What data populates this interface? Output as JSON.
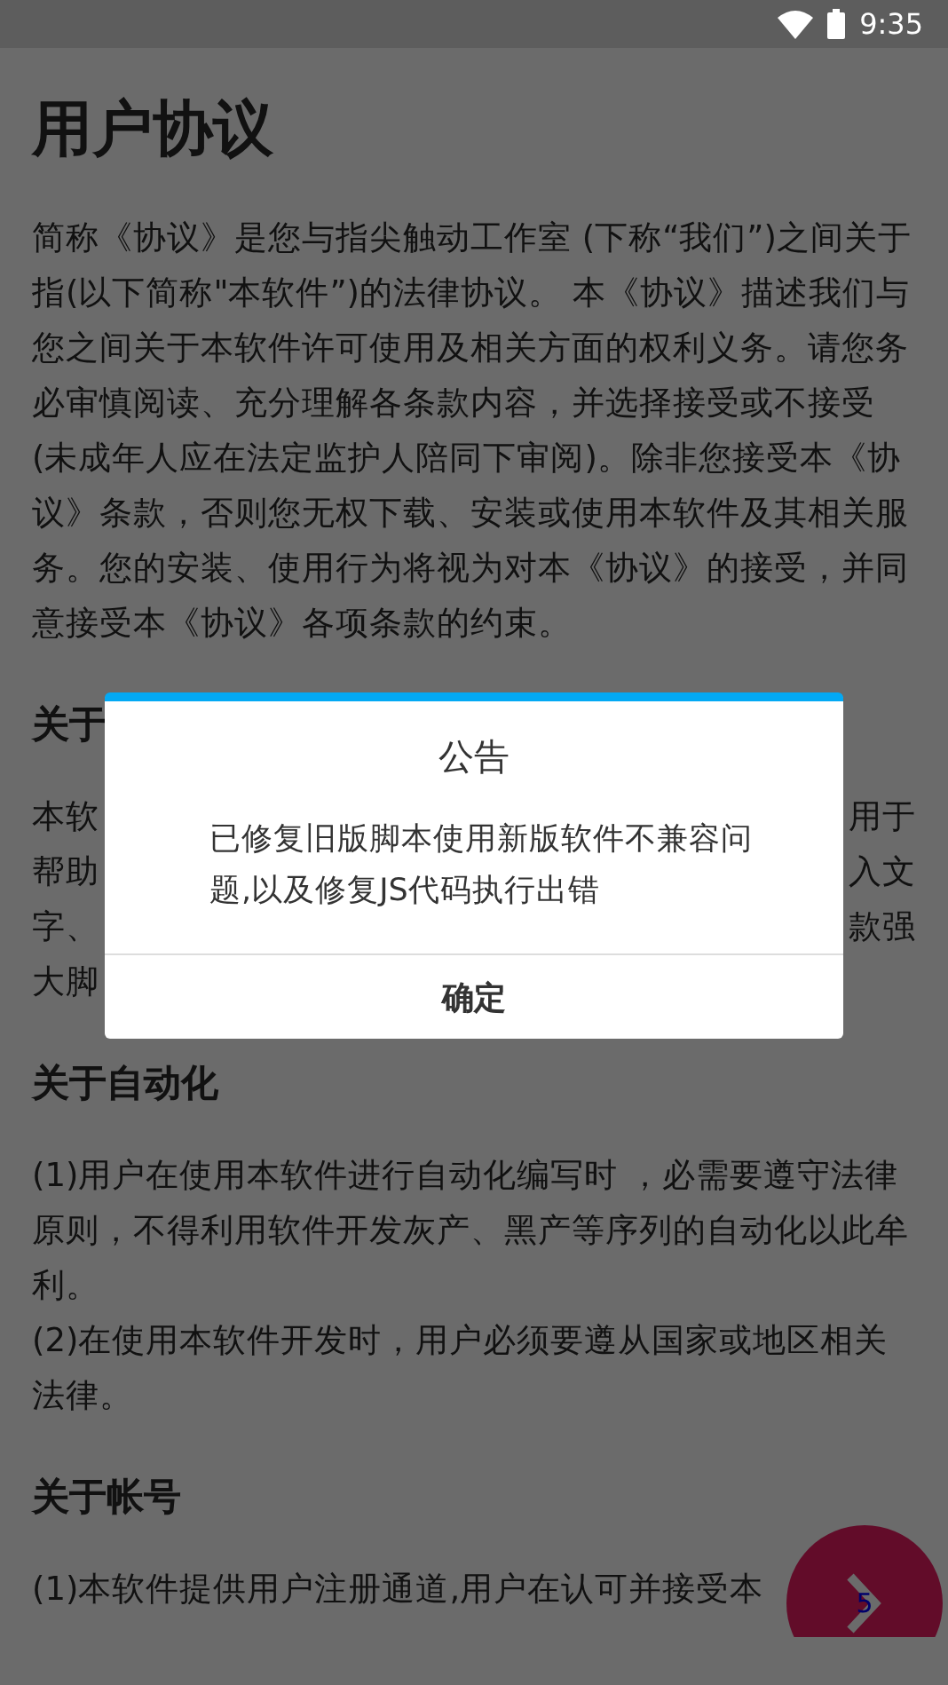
{
  "status_bar": {
    "time": "9:35"
  },
  "title": "用户协议",
  "sections": [
    {
      "kind": "text",
      "paragraphs": [
        "简称《协议》是您与指尖触动工作室 (下称“我们”)之间关于指(以下简称\"本软件”)的法律协议。 本《协议》描述我们与您之间关于本软件许可使用及相关方面的权利义务。请您务必审慎阅读、充分理解各条款内容，并选择接受或不接受(未成年人应在法定监护人陪同下审阅)。除非您接受本《协议》条款，否则您无权下载、安装或使用本软件及其相关服务。您的安装、使用行为将视为对本《协议》的接受，并同意接受本《协议》各项条款的约束。"
      ]
    },
    {
      "kind": "covered",
      "heading": "关于",
      "lines": [
        {
          "left": "本软",
          "right": "用于"
        },
        {
          "left": "帮助",
          "right": "入文"
        },
        {
          "left": "字、",
          "right": "款强"
        },
        {
          "left": "大脚"
        }
      ]
    },
    {
      "kind": "text",
      "heading": "关于自动化",
      "paragraphs": [
        "(1)用户在使用本软件进行自动化编写时 ，必需要遵守法律原则，不得利用软件开发灰产、黑产等序列的自动化以此牟利。",
        "(2)在使用本软件开发时，用户必须要遵从国家或地区相关法律。"
      ]
    },
    {
      "kind": "text",
      "heading": "关于帐号",
      "paragraphs": [
        "(1)本软件提供用户注册通道,用户在认可并接受本"
      ]
    }
  ],
  "fab": {
    "badge": "5"
  },
  "dialog": {
    "title": "公告",
    "message": "已修复旧版脚本使用新版软件不兼容问题,以及修复JS代码执行出错",
    "button": "确定"
  }
}
